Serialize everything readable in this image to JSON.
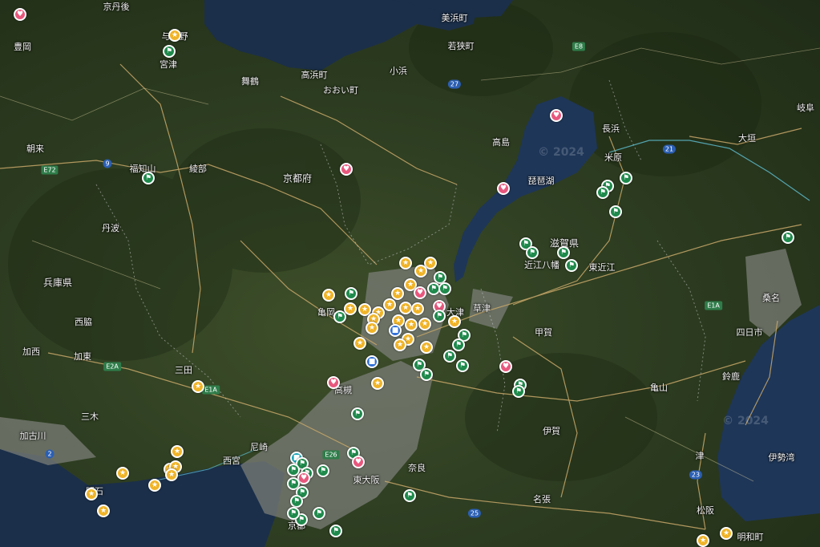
{
  "map": {
    "colors": {
      "land": "#2f3f22",
      "water": "#1b2f4a",
      "road": "#c9a86a",
      "urban": "#8a8c86"
    },
    "watermark": "© 2024",
    "place_labels": [
      {
        "id": "label-kyotango",
        "text": "京丹後"
      },
      {
        "id": "label-yosano",
        "text": "与謝野"
      },
      {
        "id": "label-toyooka",
        "text": "豊岡"
      },
      {
        "id": "label-miyazu",
        "text": "宮津"
      },
      {
        "id": "label-maizuru",
        "text": "舞鶴"
      },
      {
        "id": "label-takahama",
        "text": "高浜町"
      },
      {
        "id": "label-oi",
        "text": "おおい町"
      },
      {
        "id": "label-obama",
        "text": "小浜"
      },
      {
        "id": "label-mihama",
        "text": "美浜町"
      },
      {
        "id": "label-wakasa",
        "text": "若狭町"
      },
      {
        "id": "label-kyoto-pref",
        "text": "京都府"
      },
      {
        "id": "label-asago",
        "text": "朝来"
      },
      {
        "id": "label-fukuchiyama",
        "text": "福知山"
      },
      {
        "id": "label-ayabe",
        "text": "綾部"
      },
      {
        "id": "label-tamba",
        "text": "丹波"
      },
      {
        "id": "label-hyogo",
        "text": "兵庫県"
      },
      {
        "id": "label-nishiwaki",
        "text": "西脇"
      },
      {
        "id": "label-kasai",
        "text": "加西"
      },
      {
        "id": "label-kato",
        "text": "加東"
      },
      {
        "id": "label-sanda",
        "text": "三田"
      },
      {
        "id": "label-miki",
        "text": "三木"
      },
      {
        "id": "label-kakogawa",
        "text": "加古川"
      },
      {
        "id": "label-akashi",
        "text": "明石"
      },
      {
        "id": "label-kameoka",
        "text": "亀岡"
      },
      {
        "id": "label-takatsuki",
        "text": "高槻"
      },
      {
        "id": "label-amagasaki",
        "text": "尼崎"
      },
      {
        "id": "label-nishinomiya",
        "text": "西宮"
      },
      {
        "id": "label-higashiosaka",
        "text": "東大阪"
      },
      {
        "id": "label-kyoto",
        "text": "京都"
      },
      {
        "id": "label-nara",
        "text": "奈良"
      },
      {
        "id": "label-otsu",
        "text": "大津"
      },
      {
        "id": "label-kusatsu",
        "text": "草津"
      },
      {
        "id": "label-koka",
        "text": "甲賀"
      },
      {
        "id": "label-iga",
        "text": "伊賀"
      },
      {
        "id": "label-nabari",
        "text": "名張"
      },
      {
        "id": "label-kameyama",
        "text": "亀山"
      },
      {
        "id": "label-suzuka",
        "text": "鈴鹿"
      },
      {
        "id": "label-yokkaichi",
        "text": "四日市"
      },
      {
        "id": "label-kuwana",
        "text": "桑名"
      },
      {
        "id": "label-tsu",
        "text": "津"
      },
      {
        "id": "label-matsusaka",
        "text": "松阪"
      },
      {
        "id": "label-meiwa",
        "text": "明和町"
      },
      {
        "id": "label-shiga",
        "text": "滋賀県"
      },
      {
        "id": "label-omihachiman",
        "text": "近江八幡"
      },
      {
        "id": "label-higashiomi",
        "text": "東近江"
      },
      {
        "id": "label-takashima",
        "text": "高島"
      },
      {
        "id": "label-nagahama",
        "text": "長浜"
      },
      {
        "id": "label-maibara",
        "text": "米原"
      },
      {
        "id": "label-biwako",
        "text": "琵琶湖"
      },
      {
        "id": "label-ogaki",
        "text": "大垣"
      },
      {
        "id": "label-gifu",
        "text": "岐阜"
      },
      {
        "id": "label-ise-bay",
        "text": "伊勢湾"
      }
    ],
    "road_shields": [
      "E72",
      "9",
      "E2A",
      "2",
      "E8",
      "27",
      "21",
      "E1A",
      "E26",
      "23",
      "25",
      "E1A"
    ]
  }
}
